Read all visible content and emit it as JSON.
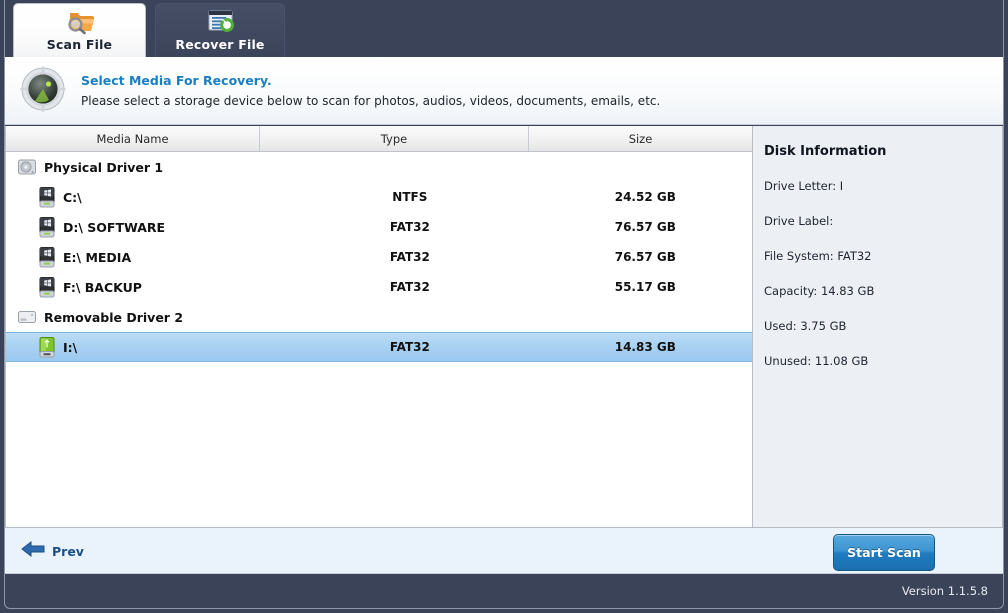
{
  "window": {
    "accent_blue": "#1a7fc1",
    "dark_navy": "#3b4358",
    "selection_blue": "#a8d1f2"
  },
  "tabs": [
    {
      "label": "Scan File",
      "icon": "folder-search-icon",
      "active": true
    },
    {
      "label": "Recover File",
      "icon": "document-refresh-icon",
      "active": false
    }
  ],
  "banner": {
    "icon": "radar-scan-icon",
    "title": "Select Media For Recovery.",
    "subtitle": "Please select a storage device below to scan for photos, audios, videos, documents, emails, etc."
  },
  "table": {
    "columns": [
      "Media Name",
      "Type",
      "Size"
    ],
    "rows": [
      {
        "kind": "group",
        "icon": "hard-disk-icon",
        "name": "Physical Driver 1",
        "type": "",
        "size": "",
        "selected": false
      },
      {
        "kind": "child",
        "icon": "windows-drive-icon",
        "name": "C:\\",
        "type": "NTFS",
        "size": "24.52 GB",
        "selected": false
      },
      {
        "kind": "child",
        "icon": "windows-drive-icon",
        "name": "D:\\ SOFTWARE",
        "type": "FAT32",
        "size": "76.57 GB",
        "selected": false
      },
      {
        "kind": "child",
        "icon": "windows-drive-icon",
        "name": "E:\\ MEDIA",
        "type": "FAT32",
        "size": "76.57 GB",
        "selected": false
      },
      {
        "kind": "child",
        "icon": "windows-drive-icon",
        "name": "F:\\ BACKUP",
        "type": "FAT32",
        "size": "55.17 GB",
        "selected": false
      },
      {
        "kind": "group",
        "icon": "removable-disk-icon",
        "name": "Removable Driver 2",
        "type": "",
        "size": "",
        "selected": false
      },
      {
        "kind": "child",
        "icon": "usb-drive-icon",
        "name": "I:\\",
        "type": "FAT32",
        "size": "14.83 GB",
        "selected": true
      }
    ]
  },
  "disk_info": {
    "title": "Disk Information",
    "drive_letter": "Drive Letter: I",
    "drive_label": "Drive Label:",
    "file_system": "File System: FAT32",
    "capacity": "Capacity: 14.83 GB",
    "used": "Used: 3.75 GB",
    "unused": "Unused: 11.08 GB"
  },
  "actions": {
    "prev_label": "Prev",
    "prev_icon": "arrow-left-icon",
    "start_scan_label": "Start Scan"
  },
  "footer": {
    "version": "Version 1.1.5.8"
  }
}
